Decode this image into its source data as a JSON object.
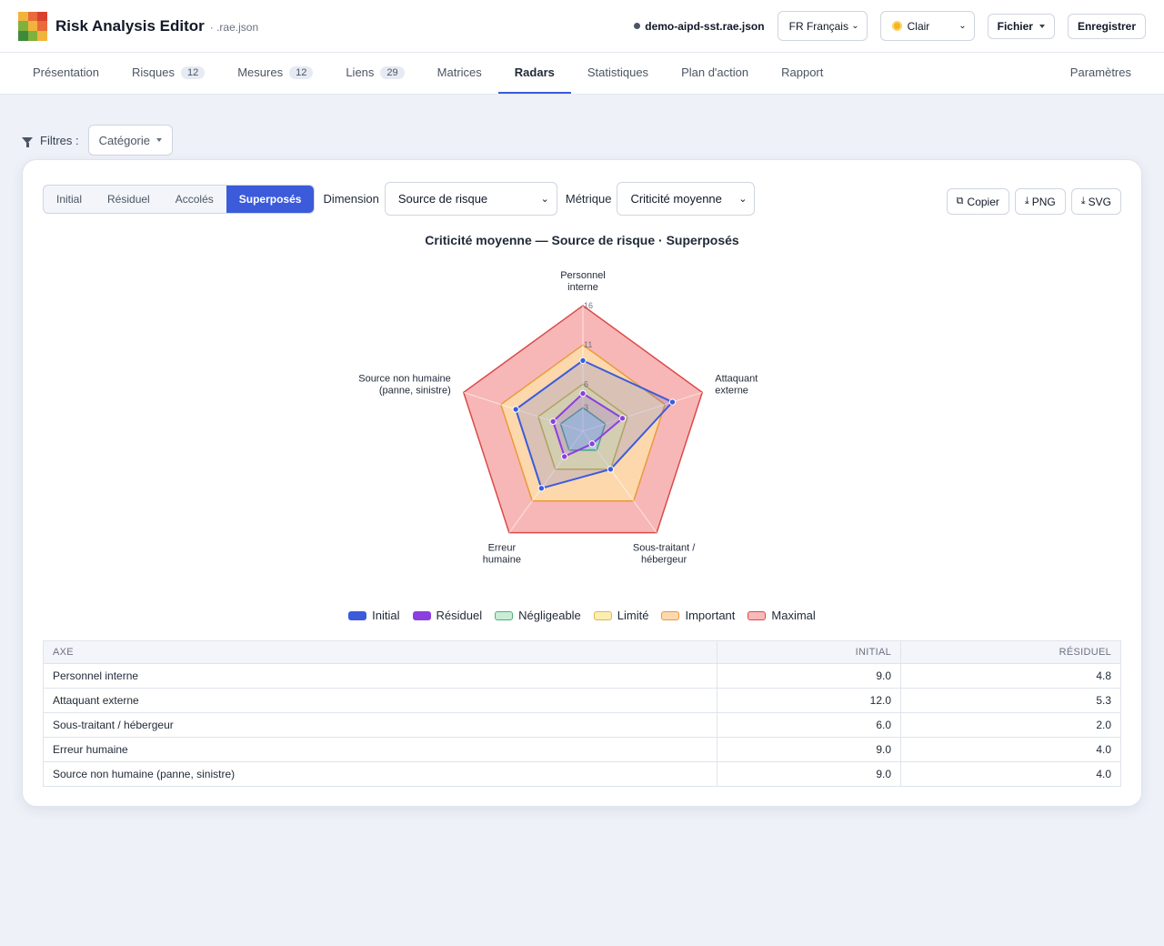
{
  "header": {
    "title": "Risk Analysis Editor",
    "subtitle": "· .rae.json",
    "filename": "demo-aipd-sst.rae.json",
    "language": "FR Français",
    "theme": "Clair",
    "file_menu": "Fichier",
    "save": "Enregistrer"
  },
  "tabs": [
    {
      "label": "Présentation",
      "badge": ""
    },
    {
      "label": "Risques",
      "badge": "12"
    },
    {
      "label": "Mesures",
      "badge": "12"
    },
    {
      "label": "Liens",
      "badge": "29"
    },
    {
      "label": "Matrices",
      "badge": ""
    },
    {
      "label": "Radars",
      "badge": "",
      "active": true
    },
    {
      "label": "Statistiques",
      "badge": ""
    },
    {
      "label": "Plan d'action",
      "badge": ""
    },
    {
      "label": "Rapport",
      "badge": ""
    }
  ],
  "settings_tab": "Paramètres",
  "filters": {
    "label": "Filtres :",
    "category": "Catégorie"
  },
  "controls": {
    "views": [
      "Initial",
      "Résiduel",
      "Accolés",
      "Superposés"
    ],
    "active_view": "Superposés",
    "dimension_label": "Dimension",
    "dimension_value": "Source de risque",
    "metric_label": "Métrique",
    "metric_value": "Criticité moyenne"
  },
  "exports": {
    "copy": "Copier",
    "png": "PNG",
    "svg": "SVG"
  },
  "chart_data": {
    "type": "radar",
    "title": "Criticité moyenne — Source de risque · Superposés",
    "axes": [
      [
        "Personnel",
        "interne"
      ],
      [
        "Attaquant",
        "externe"
      ],
      [
        "Sous-traitant /",
        "hébergeur"
      ],
      [
        "Erreur",
        "humaine"
      ],
      [
        "Source non humaine",
        "(panne, sinistre)"
      ]
    ],
    "ticks": [
      3,
      6,
      11,
      16
    ],
    "rmax": 16,
    "zones": [
      {
        "name": "Maximal",
        "value": 16,
        "fill": "#f7b7b7",
        "stroke": "#dc4a4a"
      },
      {
        "name": "Important",
        "value": 11,
        "fill": "#fdd8ad",
        "stroke": "#ea9a3a"
      },
      {
        "name": "Limité",
        "value": 6,
        "fill": "#f5e7a8",
        "stroke": "#c9b24c"
      },
      {
        "name": "Négligeable",
        "value": 3,
        "fill": "#bfe7cf",
        "stroke": "#4fb07a"
      }
    ],
    "series": [
      {
        "name": "Initial",
        "values": [
          9.0,
          12.0,
          6.0,
          9.0,
          9.0
        ],
        "color": "#3b5bdb"
      },
      {
        "name": "Résiduel",
        "values": [
          4.8,
          5.3,
          2.0,
          4.0,
          4.0
        ],
        "color": "#8b3fe0"
      }
    ],
    "legend": [
      {
        "name": "Initial",
        "fill": "#3b5bdb",
        "stroke": "#3b5bdb"
      },
      {
        "name": "Résiduel",
        "fill": "#8b3fe0",
        "stroke": "#8b3fe0"
      },
      {
        "name": "Négligeable",
        "fill": "#c9ecd8",
        "stroke": "#4fb07a"
      },
      {
        "name": "Limité",
        "fill": "#fbeeb0",
        "stroke": "#d6bb55"
      },
      {
        "name": "Important",
        "fill": "#fdd8ad",
        "stroke": "#ea9a3a"
      },
      {
        "name": "Maximal",
        "fill": "#f9b9b9",
        "stroke": "#dc4a4a"
      }
    ]
  },
  "table": {
    "headers": [
      "AXE",
      "INITIAL",
      "RÉSIDUEL"
    ],
    "rows": [
      [
        "Personnel interne",
        "9.0",
        "4.8"
      ],
      [
        "Attaquant externe",
        "12.0",
        "5.3"
      ],
      [
        "Sous-traitant / hébergeur",
        "6.0",
        "2.0"
      ],
      [
        "Erreur humaine",
        "9.0",
        "4.0"
      ],
      [
        "Source non humaine (panne, sinistre)",
        "9.0",
        "4.0"
      ]
    ]
  }
}
